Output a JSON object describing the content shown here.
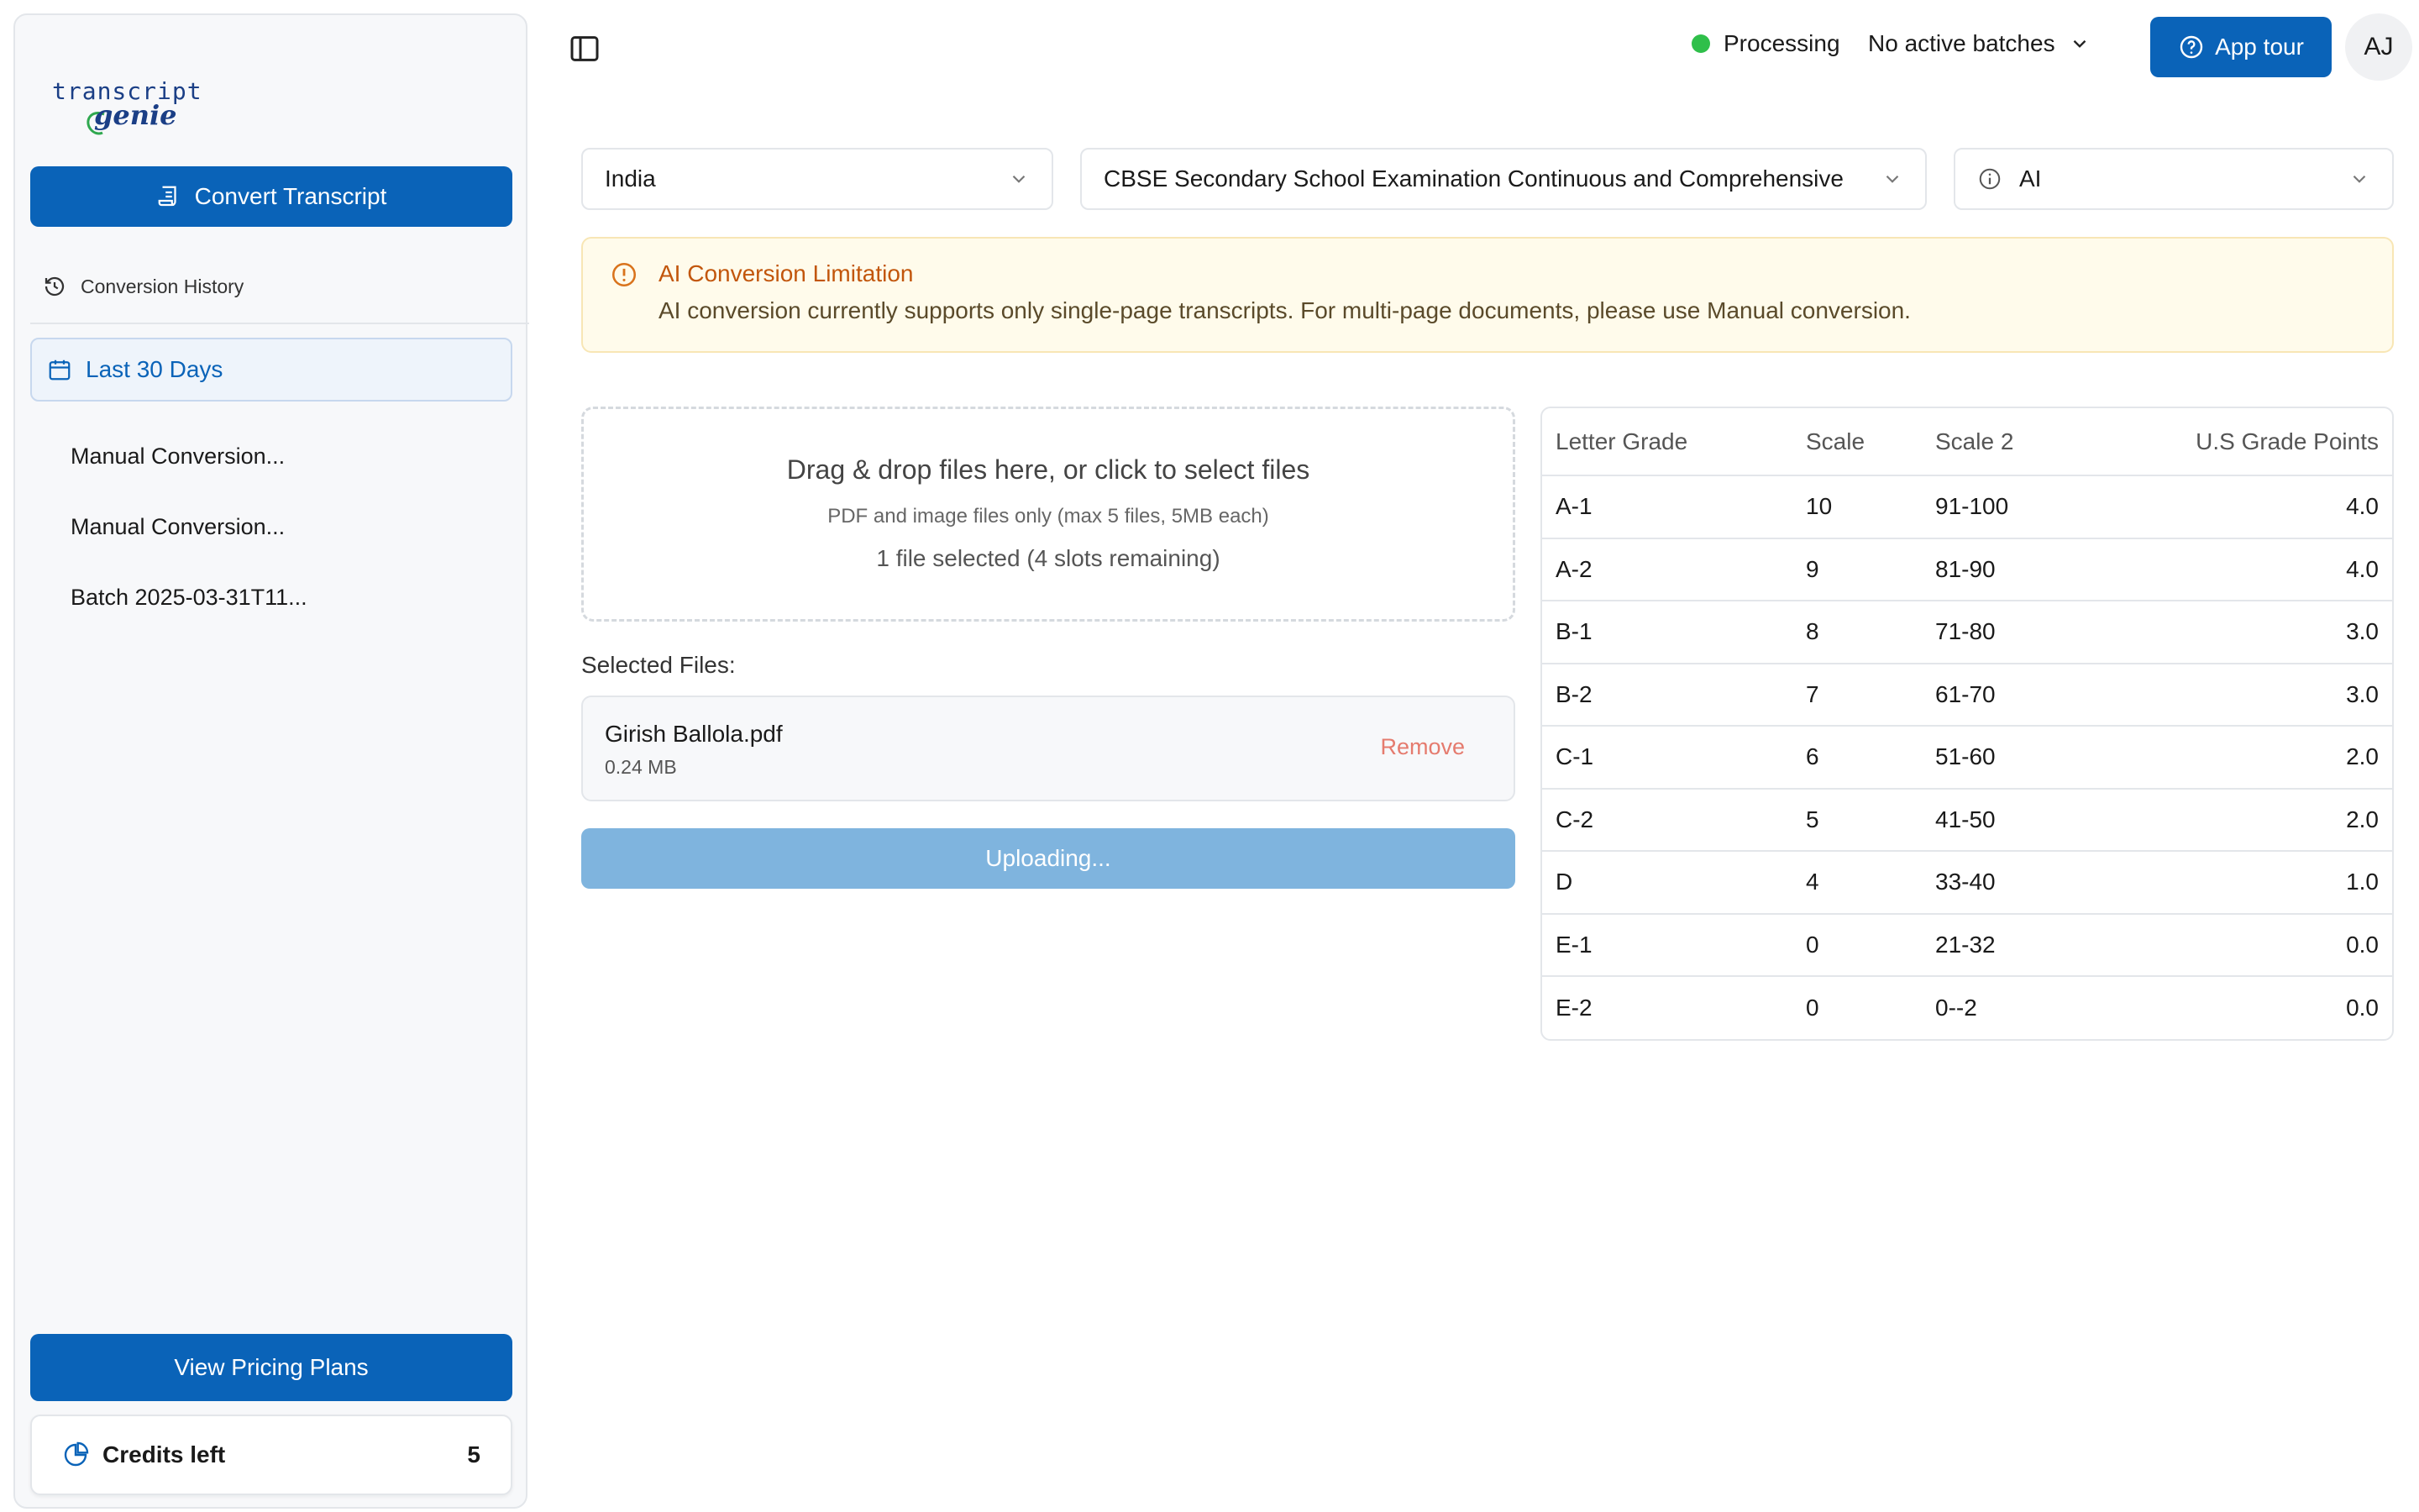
{
  "logo": {
    "line1": "transcript",
    "line2": "genie"
  },
  "sidebar": {
    "convert_label": "Convert Transcript",
    "history_label": "Conversion History",
    "filter_label": "Last 30 Days",
    "history_items": [
      "Manual Conversion...",
      "Manual Conversion...",
      "Batch 2025-03-31T11..."
    ],
    "pricing_label": "View Pricing Plans",
    "credits_label": "Credits left",
    "credits_value": "5"
  },
  "topbar": {
    "status_label": "Processing",
    "batches_label": "No active batches",
    "tour_label": "App tour",
    "avatar_initials": "AJ"
  },
  "selects": {
    "country": "India",
    "board": "CBSE Secondary School Examination Continuous and Comprehensive",
    "mode": "AI"
  },
  "alert": {
    "title": "AI Conversion Limitation",
    "message": "AI conversion currently supports only single-page transcripts. For multi-page documents, please use Manual conversion."
  },
  "dropzone": {
    "main": "Drag & drop files here, or click to select files",
    "sub": "PDF and image files only (max 5 files, 5MB each)",
    "count": "1 file selected (4 slots remaining)"
  },
  "files": {
    "label": "Selected Files:",
    "items": [
      {
        "name": "Girish Ballola.pdf",
        "size": "0.24 MB",
        "remove": "Remove"
      }
    ]
  },
  "upload_label": "Uploading...",
  "grade_table": {
    "headers": [
      "Letter Grade",
      "Scale",
      "Scale 2",
      "U.S Grade Points"
    ],
    "rows": [
      [
        "A-1",
        "10",
        "91-100",
        "4.0"
      ],
      [
        "A-2",
        "9",
        "81-90",
        "4.0"
      ],
      [
        "B-1",
        "8",
        "71-80",
        "3.0"
      ],
      [
        "B-2",
        "7",
        "61-70",
        "3.0"
      ],
      [
        "C-1",
        "6",
        "51-60",
        "2.0"
      ],
      [
        "C-2",
        "5",
        "41-50",
        "2.0"
      ],
      [
        "D",
        "4",
        "33-40",
        "1.0"
      ],
      [
        "E-1",
        "0",
        "21-32",
        "0.0"
      ],
      [
        "E-2",
        "0",
        "0--2",
        "0.0"
      ]
    ]
  },
  "colors": {
    "primary": "#0a63b8",
    "status_green": "#2fbf4a",
    "alert_bg": "#fffbeb",
    "alert_title": "#c2560c",
    "remove": "#e57b6e",
    "upload_disabled": "#7fb4de"
  }
}
